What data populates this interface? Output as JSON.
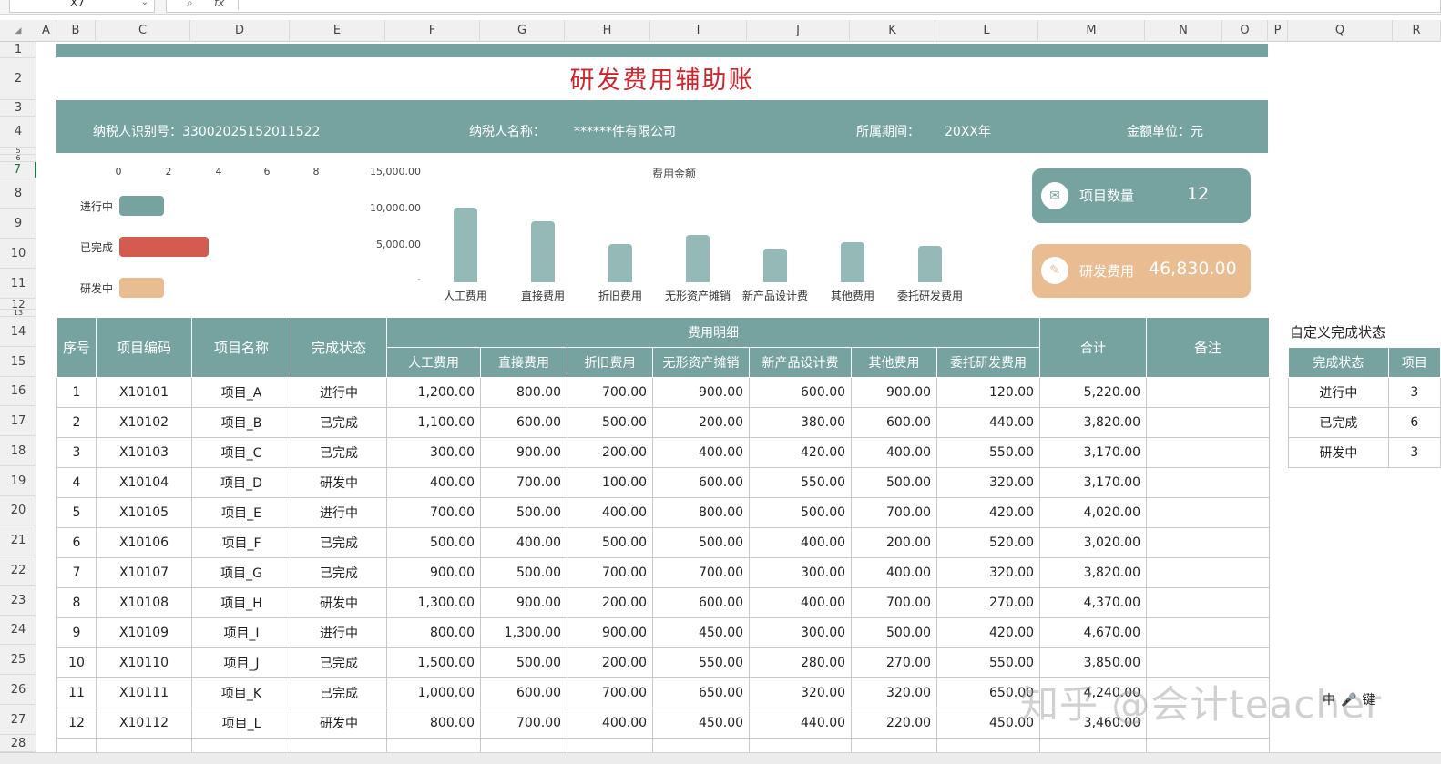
{
  "formula_bar": {
    "cell_ref": "X7",
    "fx": "fx"
  },
  "columns": [
    "A",
    "B",
    "C",
    "D",
    "E",
    "F",
    "G",
    "H",
    "I",
    "J",
    "K",
    "L",
    "M",
    "N",
    "O",
    "P",
    "Q",
    "R"
  ],
  "rows": [
    "1",
    "2",
    "3",
    "4",
    "5",
    "6",
    "7",
    "8",
    "9",
    "10",
    "11",
    "12",
    "13",
    "14",
    "15",
    "16",
    "17",
    "18",
    "19",
    "20",
    "21",
    "22",
    "23",
    "24",
    "25",
    "26",
    "27",
    "28"
  ],
  "title": "研发费用辅助账",
  "info": {
    "taxpayer_id": "纳税人识别号：33002025152011522",
    "taxpayer_name_label": "纳税人名称：",
    "taxpayer_name": "******件有限公司",
    "period_label": "所属期间：",
    "period": "20XX年",
    "unit": "金额单位：元"
  },
  "status_chart": {
    "ticks": [
      "0",
      "2",
      "4",
      "6",
      "8"
    ],
    "bars": [
      {
        "label": "进行中",
        "value": 3,
        "color": "#76a3a0"
      },
      {
        "label": "已完成",
        "value": 6,
        "color": "#d45b4f"
      },
      {
        "label": "研发中",
        "value": 3,
        "color": "#e9bc92"
      }
    ]
  },
  "chart_data": {
    "type": "bar",
    "title": "费用金额",
    "categories": [
      "人工费用",
      "直接费用",
      "折旧费用",
      "无形资产摊销",
      "新产品设计费",
      "其他费用",
      "委托研发费用"
    ],
    "values": [
      10200,
      8400,
      5300,
      6500,
      4640,
      5500,
      4960
    ],
    "ylim": [
      0,
      15000
    ],
    "yticks": [
      "15,000.00",
      "10,000.00",
      "5,000.00",
      "-"
    ],
    "color": "#95b9b7"
  },
  "cards": {
    "count_label": "项目数量",
    "count_value": "12",
    "count_icon": "envelope-icon",
    "cost_label": "研发费用",
    "cost_value": "46,830.00",
    "cost_icon": "document-icon"
  },
  "table": {
    "headers": {
      "seq": "序号",
      "code": "项目编码",
      "name": "项目名称",
      "status": "完成状态",
      "detail": "费用明细",
      "total": "合计",
      "note": "备注"
    },
    "sub_headers": [
      "人工费用",
      "直接费用",
      "折旧费用",
      "无形资产摊销",
      "新产品设计费",
      "其他费用",
      "委托研发费用"
    ],
    "rows": [
      {
        "seq": "1",
        "code": "X10101",
        "name": "项目_A",
        "status": "进行中",
        "f": "1,200.00",
        "g": "800.00",
        "h": "700.00",
        "i": "900.00",
        "j": "600.00",
        "k": "900.00",
        "l": "120.00",
        "total": "5,220.00"
      },
      {
        "seq": "2",
        "code": "X10102",
        "name": "项目_B",
        "status": "已完成",
        "f": "1,100.00",
        "g": "600.00",
        "h": "500.00",
        "i": "200.00",
        "j": "380.00",
        "k": "600.00",
        "l": "440.00",
        "total": "3,820.00"
      },
      {
        "seq": "3",
        "code": "X10103",
        "name": "项目_C",
        "status": "已完成",
        "f": "300.00",
        "g": "900.00",
        "h": "200.00",
        "i": "400.00",
        "j": "420.00",
        "k": "400.00",
        "l": "550.00",
        "total": "3,170.00"
      },
      {
        "seq": "4",
        "code": "X10104",
        "name": "项目_D",
        "status": "研发中",
        "f": "400.00",
        "g": "700.00",
        "h": "100.00",
        "i": "600.00",
        "j": "550.00",
        "k": "500.00",
        "l": "320.00",
        "total": "3,170.00"
      },
      {
        "seq": "5",
        "code": "X10105",
        "name": "项目_E",
        "status": "进行中",
        "f": "700.00",
        "g": "500.00",
        "h": "400.00",
        "i": "800.00",
        "j": "500.00",
        "k": "700.00",
        "l": "420.00",
        "total": "4,020.00"
      },
      {
        "seq": "6",
        "code": "X10106",
        "name": "项目_F",
        "status": "已完成",
        "f": "500.00",
        "g": "400.00",
        "h": "500.00",
        "i": "500.00",
        "j": "400.00",
        "k": "200.00",
        "l": "520.00",
        "total": "3,020.00"
      },
      {
        "seq": "7",
        "code": "X10107",
        "name": "项目_G",
        "status": "已完成",
        "f": "900.00",
        "g": "500.00",
        "h": "700.00",
        "i": "700.00",
        "j": "300.00",
        "k": "400.00",
        "l": "320.00",
        "total": "3,820.00"
      },
      {
        "seq": "8",
        "code": "X10108",
        "name": "项目_H",
        "status": "研发中",
        "f": "1,300.00",
        "g": "900.00",
        "h": "200.00",
        "i": "600.00",
        "j": "400.00",
        "k": "700.00",
        "l": "270.00",
        "total": "4,370.00"
      },
      {
        "seq": "9",
        "code": "X10109",
        "name": "项目_I",
        "status": "进行中",
        "f": "800.00",
        "g": "1,300.00",
        "h": "900.00",
        "i": "450.00",
        "j": "300.00",
        "k": "500.00",
        "l": "420.00",
        "total": "4,670.00"
      },
      {
        "seq": "10",
        "code": "X10110",
        "name": "项目_J",
        "status": "已完成",
        "f": "1,500.00",
        "g": "500.00",
        "h": "200.00",
        "i": "550.00",
        "j": "280.00",
        "k": "270.00",
        "l": "550.00",
        "total": "3,850.00"
      },
      {
        "seq": "11",
        "code": "X10111",
        "name": "项目_K",
        "status": "已完成",
        "f": "1,000.00",
        "g": "600.00",
        "h": "700.00",
        "i": "650.00",
        "j": "320.00",
        "k": "320.00",
        "l": "650.00",
        "total": "4,240.00"
      },
      {
        "seq": "12",
        "code": "X10112",
        "name": "项目_L",
        "status": "研发中",
        "f": "800.00",
        "g": "700.00",
        "h": "400.00",
        "i": "450.00",
        "j": "440.00",
        "k": "220.00",
        "l": "450.00",
        "total": "3,460.00"
      }
    ]
  },
  "side": {
    "title": "自定义完成状态",
    "headers": [
      "完成状态",
      "项目"
    ],
    "rows": [
      [
        "进行中",
        "3"
      ],
      [
        "已完成",
        "6"
      ],
      [
        "研发中",
        "3"
      ]
    ]
  },
  "watermark": "知乎 @会计teacher",
  "ime": [
    "中",
    "🎤",
    "键"
  ]
}
